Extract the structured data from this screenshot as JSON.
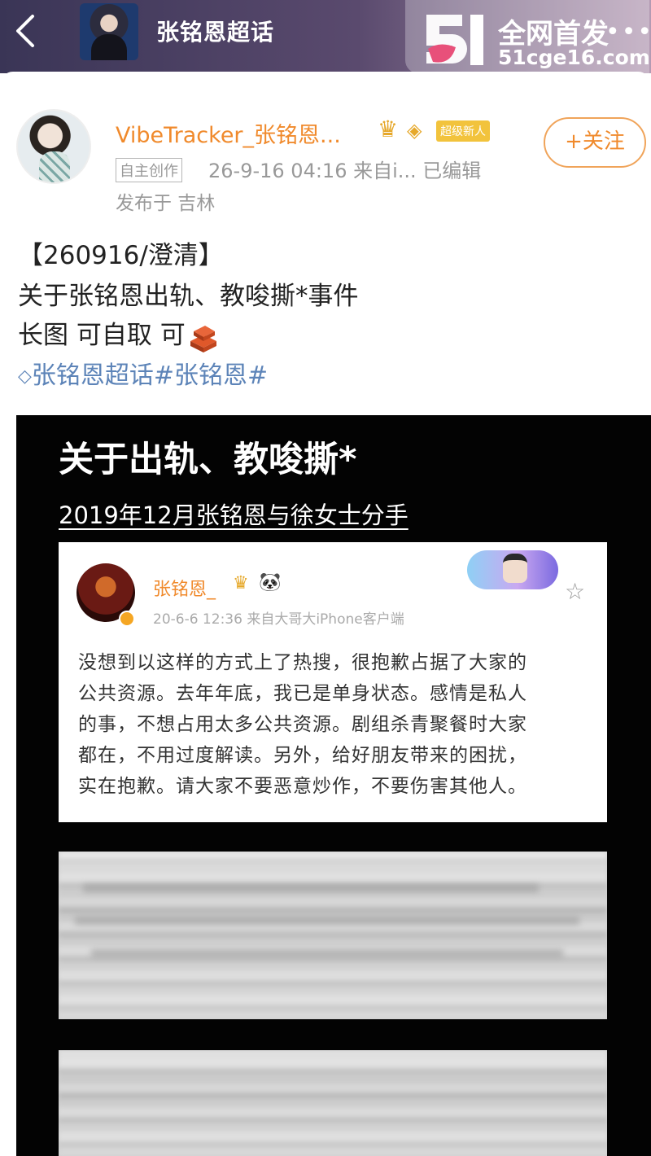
{
  "header": {
    "back_icon": "chevron-left-icon",
    "topic_title": "张铭恩超话",
    "watermark_main": "全网首发",
    "watermark_url": "51cge16.com",
    "more_label": "•••"
  },
  "post": {
    "author": {
      "name": "VibeTracker_张铭恩...",
      "badge_super": "超级新人",
      "tag_self": "自主创作",
      "meta": "26-9-16 04:16  来自i...  已编辑",
      "location": "发布于 吉林"
    },
    "follow_label": "+关注",
    "text_lines": [
      "【260916/澄清】",
      "关于张铭恩出轨、教唆撕*事件",
      "长图 可自取 可"
    ],
    "topic_links": "张铭恩超话#张铭恩#"
  },
  "long_image": {
    "title": "关于出轨、教唆撕*",
    "subtitle": "2019年12月张铭恩与徐女士分手",
    "quoted_weibo": {
      "name": "张铭恩_",
      "meta": "20-6-6 12:36  来自大哥大iPhone客户端",
      "body_lines": [
        "没想到以这样的方式上了热搜，很抱歉占据了大家的",
        "公共资源。去年年底，我已是单身状态。感情是私人",
        "的事，不想占用太多公共资源。剧组杀青聚餐时大家",
        "都在，不用过度解读。另外，给好朋友带来的困扰，",
        "实在抱歉。请大家不要恶意炒作，不要伤害其他人。"
      ]
    }
  },
  "colors": {
    "accent_orange": "#f08a2c",
    "link_blue": "#5d84b8",
    "header_dark": "#3a3556"
  }
}
